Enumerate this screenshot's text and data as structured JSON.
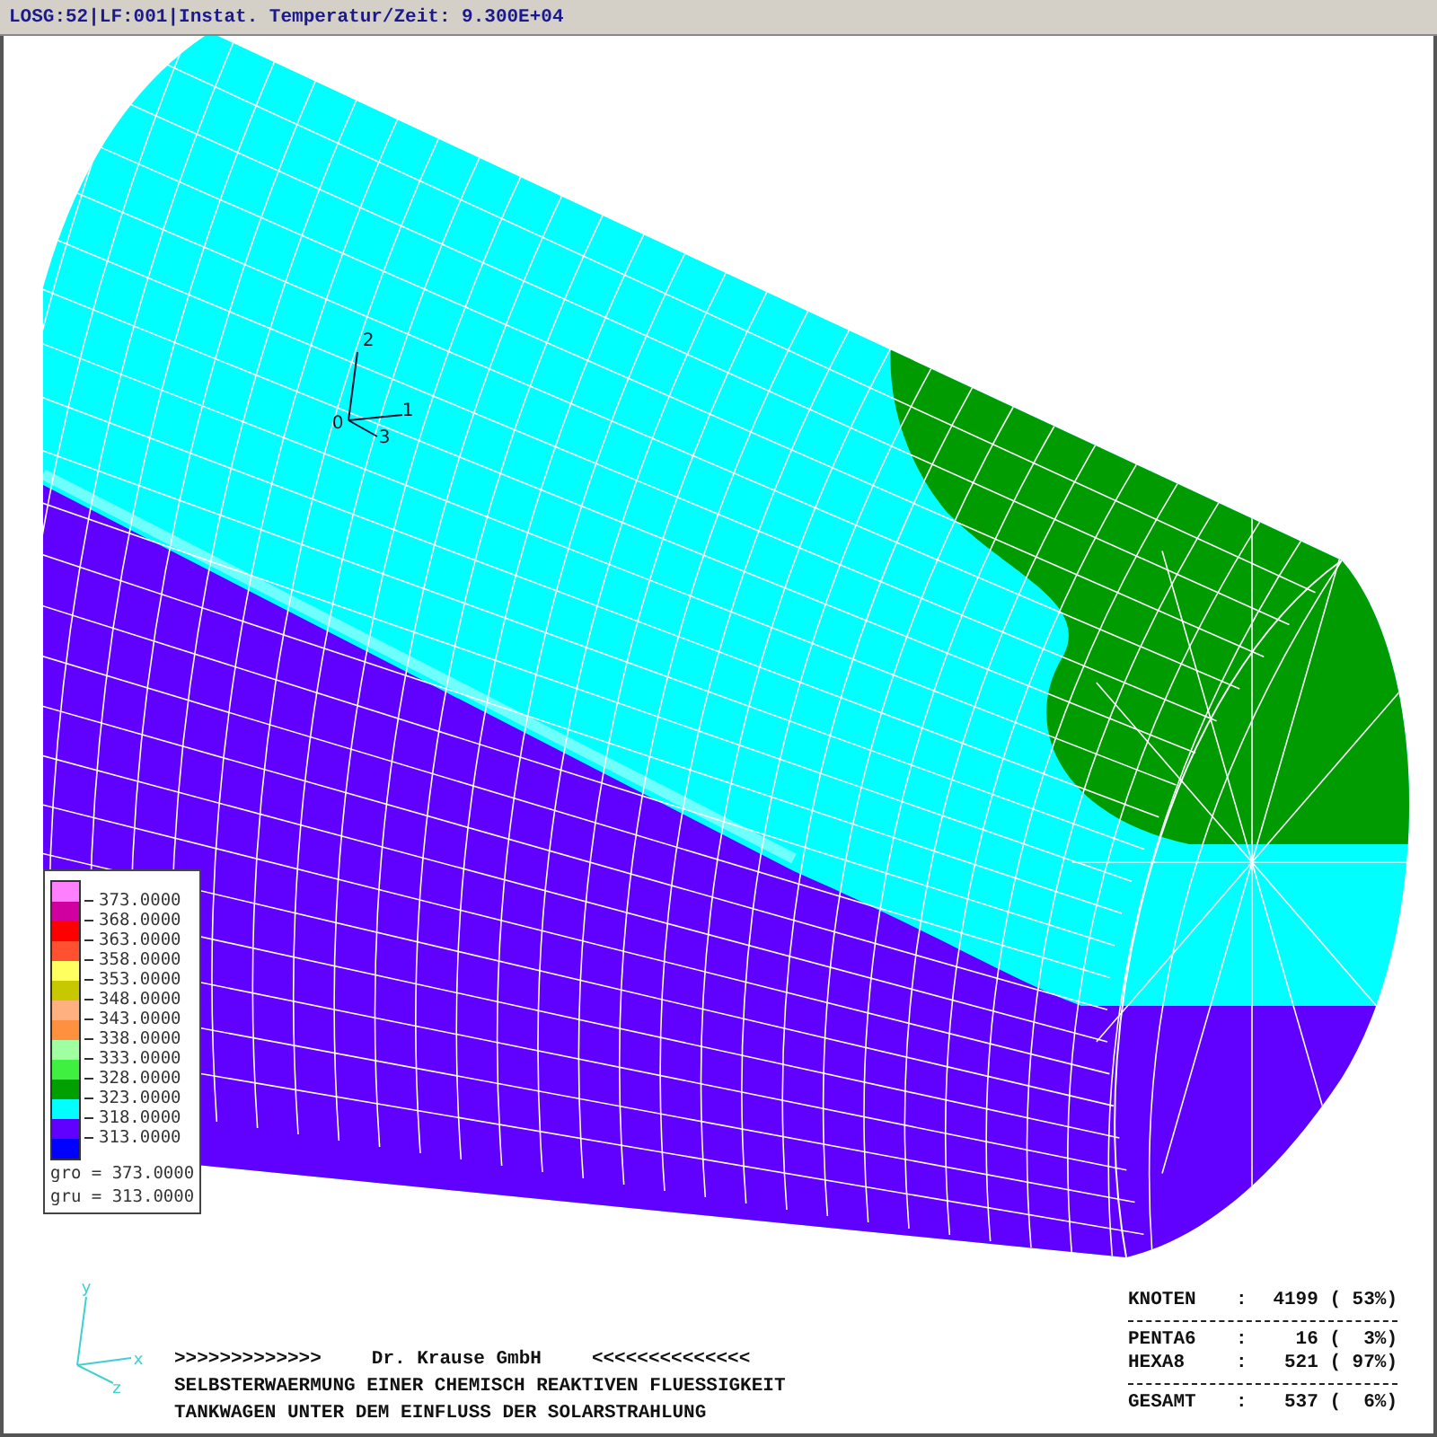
{
  "title": "LOSG:52|LF:001|Instat. Temperatur/Zeit: 9.300E+04",
  "local_axes": [
    {
      "label": "0"
    },
    {
      "label": "1"
    },
    {
      "label": "2"
    },
    {
      "label": "3"
    }
  ],
  "global_axes": [
    {
      "label": "y"
    },
    {
      "label": "x"
    },
    {
      "label": "z"
    }
  ],
  "legend": {
    "swatches": [
      {
        "color": "#ff80ff"
      },
      {
        "color": "#d000a0"
      },
      {
        "color": "#ff0000"
      },
      {
        "color": "#ff5030"
      },
      {
        "color": "#ffff60"
      },
      {
        "color": "#c8c800"
      },
      {
        "color": "#ffb080"
      },
      {
        "color": "#ff9040"
      },
      {
        "color": "#a0ffa0"
      },
      {
        "color": "#40f040"
      },
      {
        "color": "#00a000"
      },
      {
        "color": "#00ffff"
      },
      {
        "color": "#6000ff"
      },
      {
        "color": "#0000ff"
      }
    ],
    "levels": [
      {
        "label": "373.0000"
      },
      {
        "label": "368.0000"
      },
      {
        "label": "363.0000"
      },
      {
        "label": "358.0000"
      },
      {
        "label": "353.0000"
      },
      {
        "label": "348.0000"
      },
      {
        "label": "343.0000"
      },
      {
        "label": "338.0000"
      },
      {
        "label": "333.0000"
      },
      {
        "label": "328.0000"
      },
      {
        "label": "323.0000"
      },
      {
        "label": "318.0000"
      },
      {
        "label": "313.0000"
      }
    ],
    "range": [
      "gro = 373.0000",
      "gru = 313.0000"
    ]
  },
  "footer": {
    "banner_left": ">>>>>>>>>>>>>",
    "company": "Dr. Krause GmbH",
    "banner_right": "<<<<<<<<<<<<<<",
    "lines": [
      "SELBSTERWAERMUNG EINER CHEMISCH REAKTIVEN FLUESSIGKEIT",
      "TANKWAGEN UNTER DEM EINFLUSS DER SOLARSTRAHLUNG"
    ]
  },
  "stats": [
    {
      "kind": "row",
      "name": "KNOTEN",
      "separator": ":",
      "value": "4199 ( 53%)"
    },
    {
      "kind": "rule"
    },
    {
      "kind": "row",
      "name": "PENTA6",
      "separator": ":",
      "value": "16 (  3%)"
    },
    {
      "kind": "row",
      "name": "HEXA8",
      "separator": ":",
      "value": "521 ( 97%)"
    },
    {
      "kind": "rule"
    },
    {
      "kind": "row",
      "name": "GESAMT",
      "separator": ":",
      "value": "537 (  6%)"
    }
  ]
}
